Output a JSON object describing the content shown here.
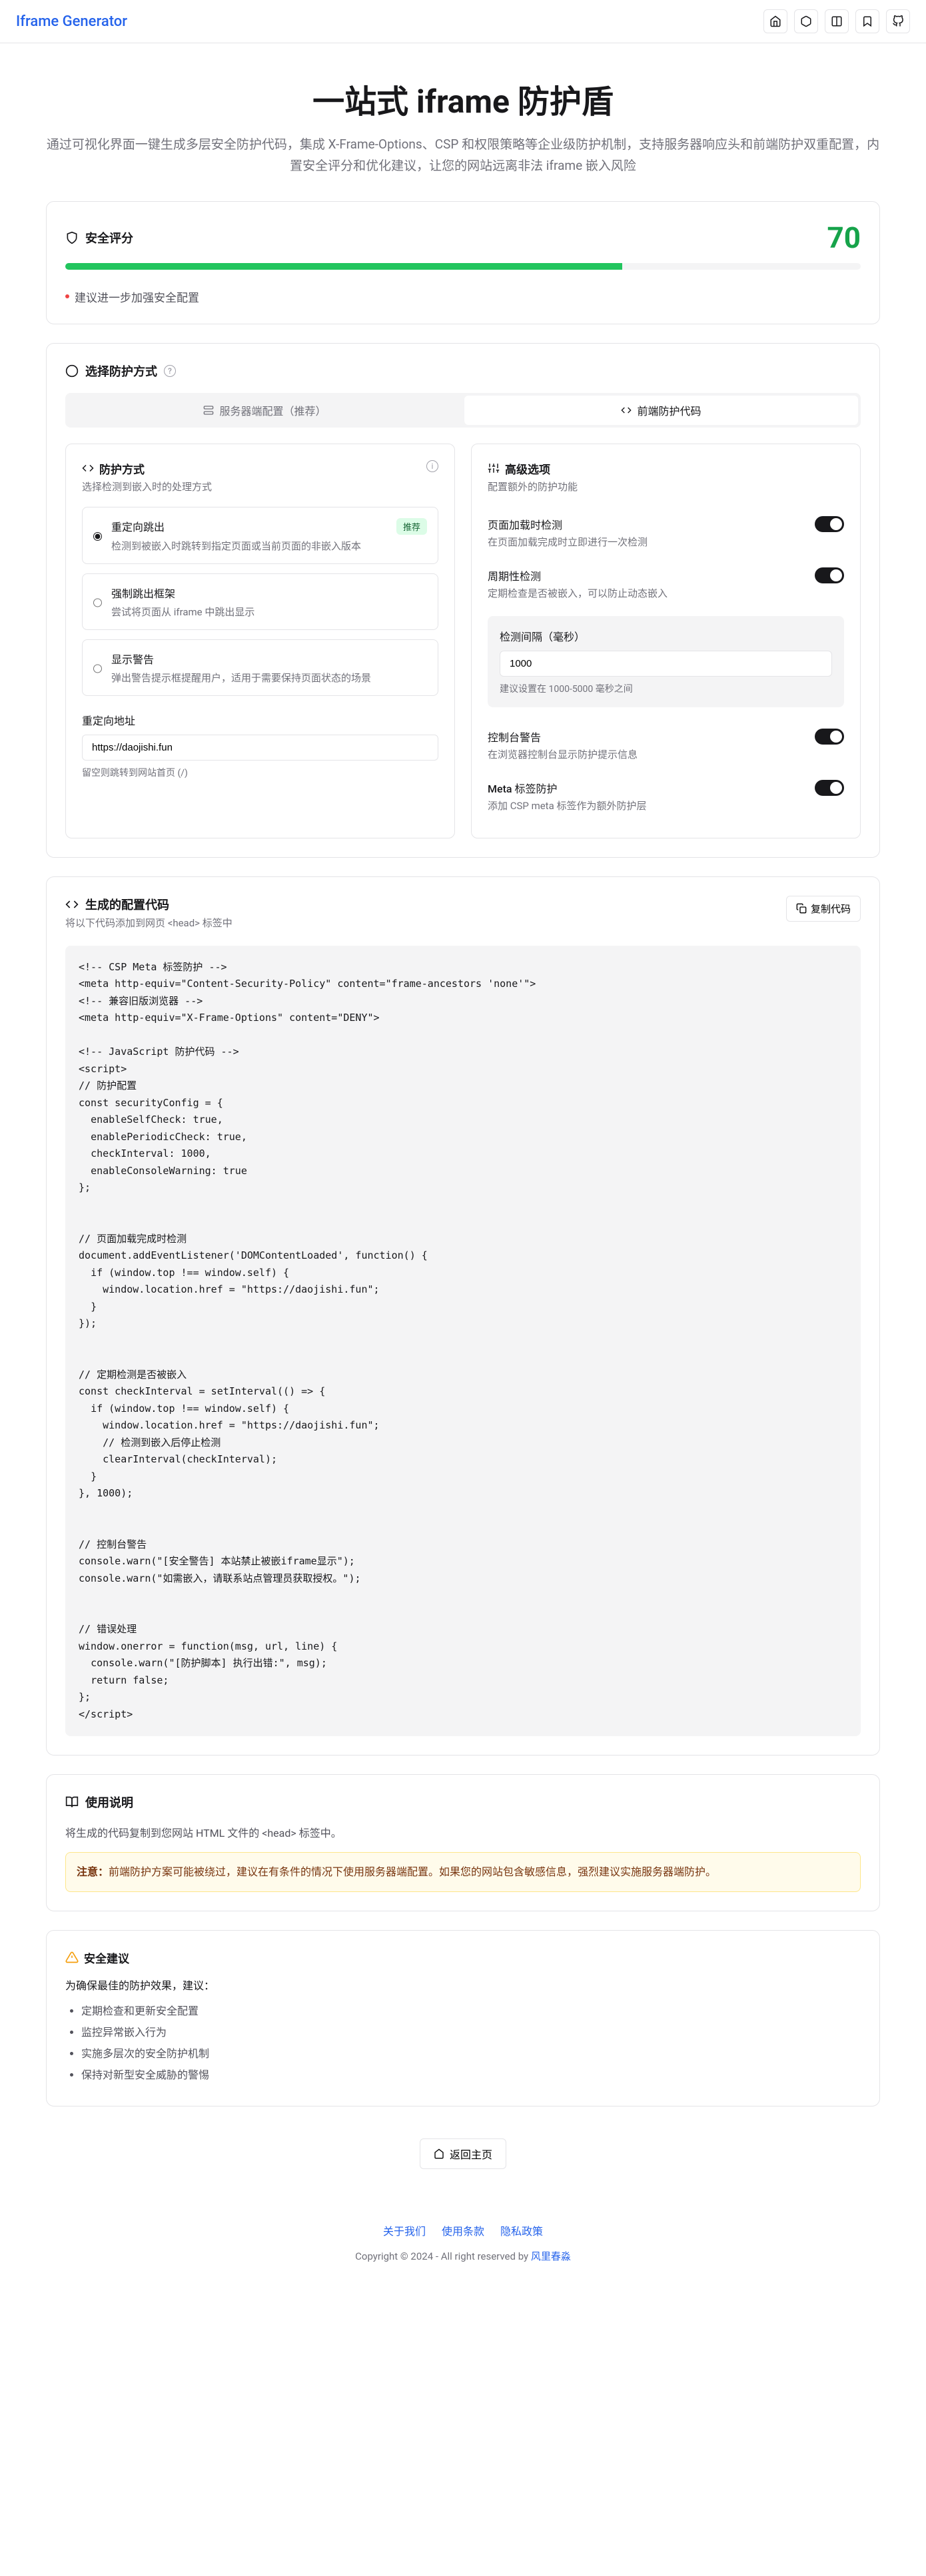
{
  "header": {
    "brand": "Iframe Generator"
  },
  "hero": {
    "title": "一站式 iframe 防护盾",
    "subtitle": "通过可视化界面一键生成多层安全防护代码，集成 X-Frame-Options、CSP 和权限策略等企业级防护机制，支持服务器响应头和前端防护双重配置，内置安全评分和优化建议，让您的网站远离非法 iframe 嵌入风险"
  },
  "score": {
    "label": "安全评分",
    "value": "70",
    "suggestion": "建议进一步加强安全配置"
  },
  "method": {
    "title": "选择防护方式",
    "tabs": {
      "server": "服务器端配置（推荐）",
      "client": "前端防护代码"
    },
    "left": {
      "title": "防护方式",
      "sub": "选择检测到嵌入时的处理方式",
      "options": [
        {
          "label": "重定向跳出",
          "badge": "推荐",
          "desc": "检测到被嵌入时跳转到指定页面或当前页面的非嵌入版本"
        },
        {
          "label": "强制跳出框架",
          "desc": "尝试将页面从 iframe 中跳出显示"
        },
        {
          "label": "显示警告",
          "desc": "弹出警告提示框提醒用户，适用于需要保持页面状态的场景"
        }
      ],
      "redirect": {
        "label": "重定向地址",
        "value": "https://daojishi.fun",
        "hint": "留空则跳转到网站首页 (/)"
      }
    },
    "right": {
      "title": "高级选项",
      "sub": "配置额外的防护功能",
      "switches": [
        {
          "label": "页面加载时检测",
          "desc": "在页面加载完成时立即进行一次检测"
        },
        {
          "label": "周期性检测",
          "desc": "定期检查是否被嵌入，可以防止动态嵌入"
        }
      ],
      "interval": {
        "label": "检测间隔（毫秒）",
        "value": "1000",
        "hint": "建议设置在 1000-5000 毫秒之间"
      },
      "switches2": [
        {
          "label": "控制台警告",
          "desc": "在浏览器控制台显示防护提示信息"
        },
        {
          "label": "Meta 标签防护",
          "desc": "添加 CSP meta 标签作为额外防护层"
        }
      ]
    }
  },
  "code": {
    "title": "生成的配置代码",
    "sub": "将以下代码添加到网页 <head> 标签中",
    "copy": "复制代码",
    "content": "<!-- CSP Meta 标签防护 -->\n<meta http-equiv=\"Content-Security-Policy\" content=\"frame-ancestors 'none'\">\n<!-- 兼容旧版浏览器 -->\n<meta http-equiv=\"X-Frame-Options\" content=\"DENY\">\n\n<!-- JavaScript 防护代码 -->\n<script>\n// 防护配置\nconst securityConfig = {\n  enableSelfCheck: true,\n  enablePeriodicCheck: true,\n  checkInterval: 1000,\n  enableConsoleWarning: true\n};\n\n\n// 页面加载完成时检测\ndocument.addEventListener('DOMContentLoaded', function() {\n  if (window.top !== window.self) {\n    window.location.href = \"https://daojishi.fun\";\n  }\n});\n\n\n// 定期检测是否被嵌入\nconst checkInterval = setInterval(() => {\n  if (window.top !== window.self) {\n    window.location.href = \"https://daojishi.fun\";\n    // 检测到嵌入后停止检测\n    clearInterval(checkInterval);\n  }\n}, 1000);\n\n\n// 控制台警告\nconsole.warn(\"[安全警告] 本站禁止被嵌iframe显示\");\nconsole.warn(\"如需嵌入，请联系站点管理员获取授权。\");\n\n\n// 错误处理\nwindow.onerror = function(msg, url, line) {\n  console.warn(\"[防护脚本] 执行出错:\", msg);\n  return false;\n};\n</script>"
  },
  "usage": {
    "title": "使用说明",
    "desc": "将生成的代码复制到您网站 HTML 文件的 <head> 标签中。",
    "alert_bold": "注意：",
    "alert_text": "前端防护方案可能被绕过，建议在有条件的情况下使用服务器端配置。如果您的网站包含敏感信息，强烈建议实施服务器端防护。"
  },
  "rec": {
    "title": "安全建议",
    "intro": "为确保最佳的防护效果，建议：",
    "items": [
      "定期检查和更新安全配置",
      "监控异常嵌入行为",
      "实施多层次的安全防护机制",
      "保持对新型安全威胁的警惕"
    ]
  },
  "back": "返回主页",
  "footer": {
    "links": [
      "关于我们",
      "使用条款",
      "隐私政策"
    ],
    "copy_prefix": "Copyright © 2024 - All right reserved by ",
    "copy_link": "风里春淼"
  }
}
